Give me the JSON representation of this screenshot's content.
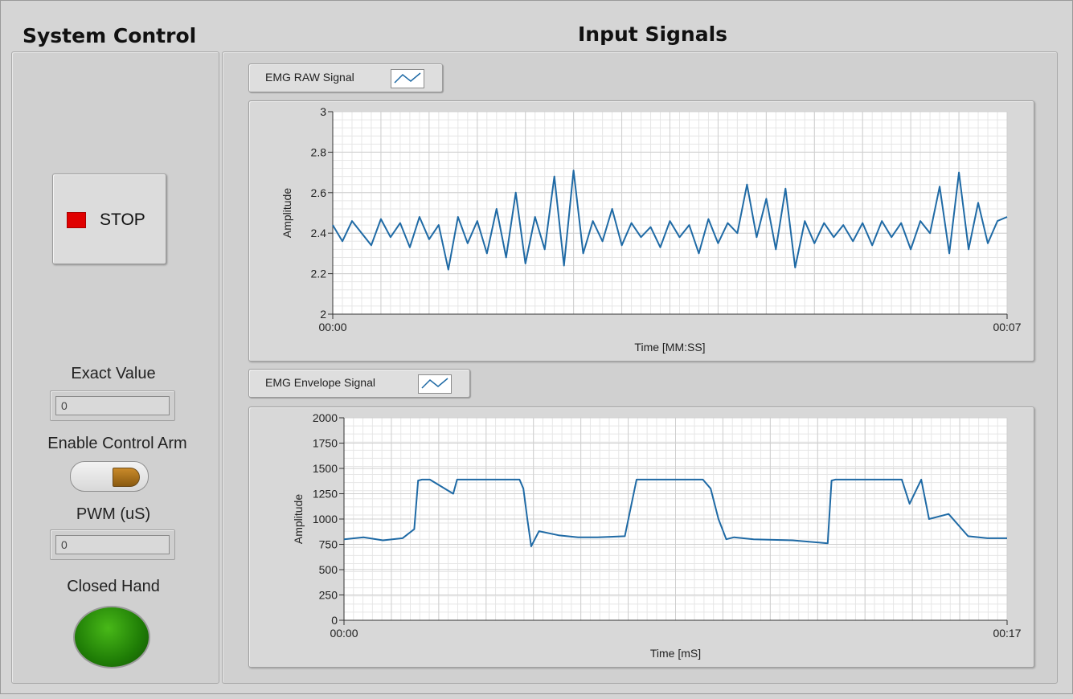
{
  "headers": {
    "system_control": "System Control",
    "input_signals": "Input Signals"
  },
  "controls": {
    "stop_label": "STOP",
    "exact_value_label": "Exact Value",
    "exact_value": "0",
    "enable_control_arm_label": "Enable Control Arm",
    "enable_control_arm_state": true,
    "pwm_label": "PWM (uS)",
    "pwm_value": "0",
    "closed_hand_label": "Closed Hand",
    "closed_hand_state": true
  },
  "colors": {
    "led_stop": "#e00000",
    "led_on": "#2a8c0a",
    "trace": "#1f6aa5",
    "toggle_on": "#b07a20"
  },
  "legends": {
    "raw": "EMG RAW Signal",
    "envelope": "EMG Envelope Signal"
  },
  "chart_data": [
    {
      "type": "line",
      "legend": "EMG RAW Signal",
      "xlabel": "Time [MM:SS]",
      "ylabel": "Amplitude",
      "x_tick_labels": [
        "00:00",
        "00:07"
      ],
      "y_ticks": [
        2,
        2.2,
        2.4,
        2.6,
        2.8,
        3
      ],
      "y_tick_labels": [
        "2",
        "2.2",
        "2.4",
        "2.6",
        "2.8",
        "3"
      ],
      "ylim": [
        2,
        3
      ],
      "xlim": [
        0,
        7
      ],
      "grid": true,
      "x": [
        0,
        0.1,
        0.2,
        0.3,
        0.4,
        0.5,
        0.6,
        0.7,
        0.8,
        0.9,
        1.0,
        1.1,
        1.2,
        1.3,
        1.4,
        1.5,
        1.6,
        1.7,
        1.8,
        1.9,
        2.0,
        2.1,
        2.2,
        2.3,
        2.4,
        2.5,
        2.6,
        2.7,
        2.8,
        2.9,
        3.0,
        3.1,
        3.2,
        3.3,
        3.4,
        3.5,
        3.6,
        3.7,
        3.8,
        3.9,
        4.0,
        4.1,
        4.2,
        4.3,
        4.4,
        4.5,
        4.6,
        4.7,
        4.8,
        4.9,
        5.0,
        5.1,
        5.2,
        5.3,
        5.4,
        5.5,
        5.6,
        5.7,
        5.8,
        5.9,
        6.0,
        6.1,
        6.2,
        6.3,
        6.4,
        6.5,
        6.6,
        6.7,
        6.8,
        6.9,
        7.0
      ],
      "y": [
        2.44,
        2.36,
        2.46,
        2.4,
        2.34,
        2.47,
        2.38,
        2.45,
        2.33,
        2.48,
        2.37,
        2.44,
        2.22,
        2.48,
        2.35,
        2.46,
        2.3,
        2.52,
        2.28,
        2.6,
        2.25,
        2.48,
        2.32,
        2.68,
        2.24,
        2.71,
        2.3,
        2.46,
        2.36,
        2.52,
        2.34,
        2.45,
        2.38,
        2.43,
        2.33,
        2.46,
        2.38,
        2.44,
        2.3,
        2.47,
        2.35,
        2.45,
        2.4,
        2.64,
        2.38,
        2.57,
        2.32,
        2.62,
        2.23,
        2.46,
        2.35,
        2.45,
        2.38,
        2.44,
        2.36,
        2.45,
        2.34,
        2.46,
        2.38,
        2.45,
        2.32,
        2.46,
        2.4,
        2.63,
        2.3,
        2.7,
        2.32,
        2.55,
        2.35,
        2.46,
        2.48
      ]
    },
    {
      "type": "line",
      "legend": "EMG Envelope Signal",
      "xlabel": "Time [mS]",
      "ylabel": "Amplitude",
      "x_tick_labels": [
        "00:00",
        "00:17"
      ],
      "y_ticks": [
        0,
        250,
        500,
        750,
        1000,
        1250,
        1500,
        1750,
        2000
      ],
      "y_tick_labels": [
        "0",
        "250",
        "500",
        "750",
        "1000",
        "1250",
        "1500",
        "1750",
        "2000"
      ],
      "ylim": [
        0,
        2000
      ],
      "xlim": [
        0,
        17
      ],
      "grid": true,
      "x": [
        0,
        0.5,
        1.0,
        1.5,
        1.8,
        1.9,
        2.0,
        2.2,
        2.8,
        2.9,
        3.0,
        3.5,
        4.5,
        4.6,
        4.7,
        4.8,
        5.0,
        5.5,
        6.0,
        6.5,
        7.2,
        7.5,
        7.7,
        8.0,
        9.2,
        9.4,
        9.6,
        9.8,
        10.0,
        10.5,
        11.5,
        12.4,
        12.5,
        12.6,
        12.8,
        13.5,
        14.3,
        14.5,
        14.8,
        15.0,
        15.5,
        16.0,
        16.5,
        17.0
      ],
      "y": [
        800,
        820,
        790,
        810,
        900,
        1380,
        1390,
        1390,
        1250,
        1390,
        1390,
        1390,
        1390,
        1300,
        1000,
        730,
        880,
        840,
        820,
        820,
        830,
        1390,
        1390,
        1390,
        1390,
        1300,
        1000,
        800,
        820,
        800,
        790,
        760,
        1380,
        1390,
        1390,
        1390,
        1390,
        1150,
        1390,
        1000,
        1050,
        830,
        810,
        810
      ]
    }
  ]
}
